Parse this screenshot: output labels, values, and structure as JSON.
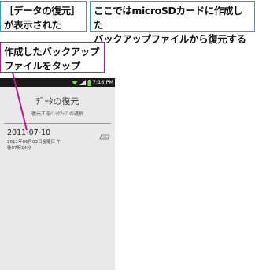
{
  "callouts": {
    "shown": "［データの復元］\nが表示された",
    "explanation": "ここではmicroSDカードに作成した\nバックアップファイルから復元する",
    "tap_instruction": "作成したバックアップ\nファイルをタップ"
  },
  "statusbar": {
    "time": "7:16 PM",
    "icons": [
      "wifi-icon",
      "signal-icon",
      "battery-icon"
    ]
  },
  "screen": {
    "title": "ﾃﾞｰﾀの復元",
    "subtitle": "復元するﾊﾞｯｸｱｯﾌﾟの選択"
  },
  "backup_list": [
    {
      "date": "2011-07-10",
      "detail": "2011年06月03日金曜日 午\n後07時14分",
      "storage_icon": "sd-card-icon"
    }
  ],
  "colors": {
    "callout_blue": "#2d9fd8",
    "callout_magenta": "#c0168c",
    "statusbar": "#1a1a1a",
    "screen_bg": "#e9e9e9"
  }
}
